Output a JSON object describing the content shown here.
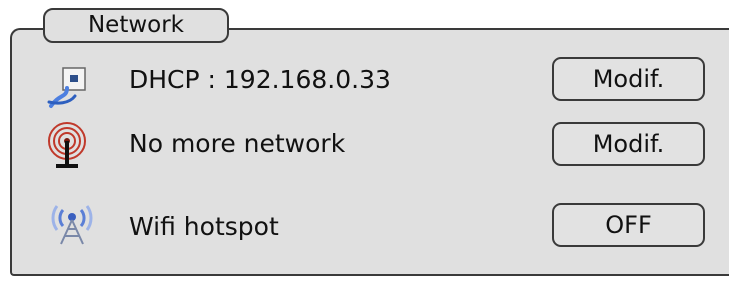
{
  "panel": {
    "title": "Network"
  },
  "rows": [
    {
      "icon": "ethernet-plug-icon",
      "label": "DHCP : 192.168.0.33",
      "button": "Modif."
    },
    {
      "icon": "antenna-icon",
      "label": "No more network",
      "button": "Modif."
    },
    {
      "icon": "wifi-tower-icon",
      "label": "Wifi hotspot",
      "button": "OFF"
    }
  ],
  "colors": {
    "panel_bg": "#e0e0e0",
    "border": "#3a3a3a",
    "antenna_red": "#c0392b",
    "wifi_blue": "#5b7fd6"
  }
}
